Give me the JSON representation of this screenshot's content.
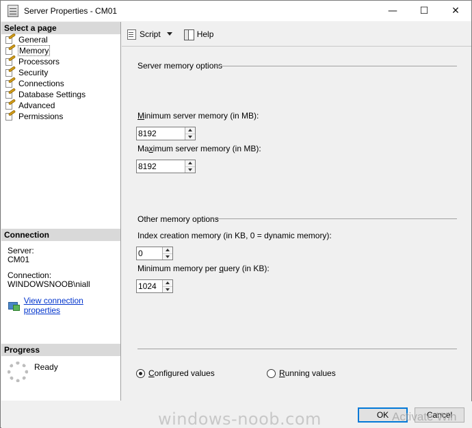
{
  "window": {
    "title": "Server Properties - CM01",
    "minimize_glyph": "—",
    "maximize_glyph": "☐",
    "close_glyph": "✕"
  },
  "left_pane": {
    "select_header": "Select a page",
    "pages": [
      "General",
      "Memory",
      "Processors",
      "Security",
      "Connections",
      "Database Settings",
      "Advanced",
      "Permissions"
    ],
    "selected_page": "Memory",
    "connection_header": "Connection",
    "server_label": "Server:",
    "server_value": "CM01",
    "connection_label": "Connection:",
    "connection_value": "WINDOWSNOOB\\niall",
    "view_link": "View connection properties",
    "progress_header": "Progress",
    "progress_status": "Ready"
  },
  "toolbar": {
    "script_label": "Script",
    "help_label": "Help"
  },
  "memory": {
    "server_group": "Server memory options",
    "min_label_u": "M",
    "min_label_rest": "inimum server memory (in MB):",
    "min_value": "8192",
    "max_label_pre": "Ma",
    "max_label_u": "x",
    "max_label_rest": "imum server memory (in MB):",
    "max_value": "8192",
    "other_group": "Other memory options",
    "index_label_pre": "Index creation memory (in KB, 0 = dynamic memory):",
    "index_value": "0",
    "query_label_pre": "Minimum memory per ",
    "query_label_u": "q",
    "query_label_rest": "uery (in KB):",
    "query_value": "1024"
  },
  "radios": {
    "configured_u": "C",
    "configured_rest": "onfigured values",
    "running_u": "R",
    "running_rest": "unning values",
    "selected": "configured"
  },
  "footer": {
    "ok_label": "OK",
    "cancel_label": "Cancel",
    "watermark": "windows-noob.com",
    "activate": "Activate Win"
  }
}
